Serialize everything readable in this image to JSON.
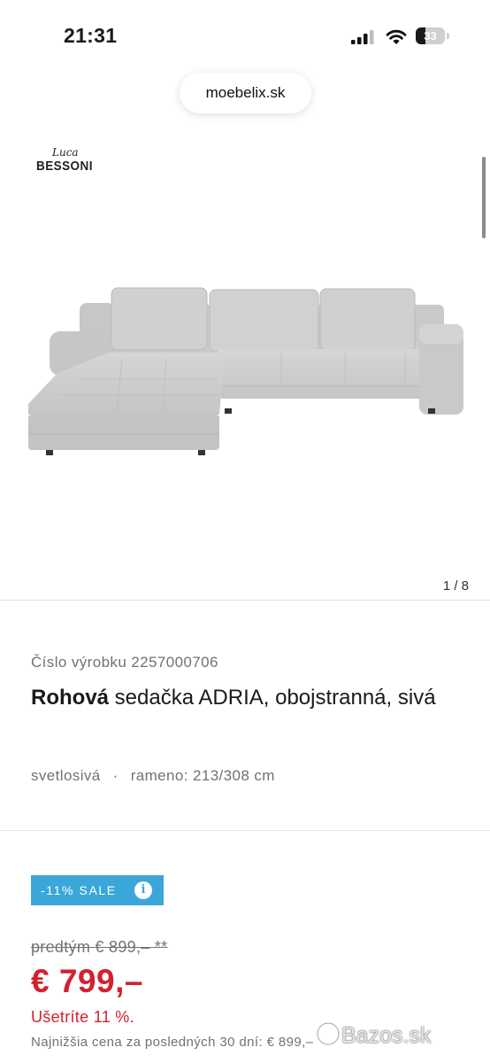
{
  "status_bar": {
    "time": "21:31",
    "battery_level": "33",
    "battery_fraction": 0.33
  },
  "browser": {
    "url": "moebelix.sk"
  },
  "brand": {
    "script_text": "Luca",
    "word_text": "BESSONI"
  },
  "gallery": {
    "counter": "1 / 8"
  },
  "product": {
    "number": "Číslo výrobku 2257000706",
    "title_bold": "Rohová",
    "title_rest": " sedačka ADRIA, obojstranná, sivá",
    "color": "svetlosivá",
    "separator": "·",
    "dimension": "rameno: 213/308 cm"
  },
  "pricing": {
    "sale_badge": "-11% SALE",
    "info_icon": "i",
    "old_price": "predtým € 899,– **",
    "new_price": "€ 799,–",
    "savings": "Ušetríte 11 %.",
    "lowest_price": "Najnižšia cena za posledných 30 dní: € 899,–"
  },
  "watermark": {
    "text": "Bazos.sk"
  },
  "colors": {
    "sale_blue": "#3aa7d8",
    "price_red": "#d4202f",
    "muted_text": "#6f7278",
    "sofa_gray": "#cdcecf"
  },
  "icons": [
    "signal-icon",
    "wifi-icon",
    "battery-icon",
    "info-icon",
    "bazos-watermark-icon"
  ]
}
